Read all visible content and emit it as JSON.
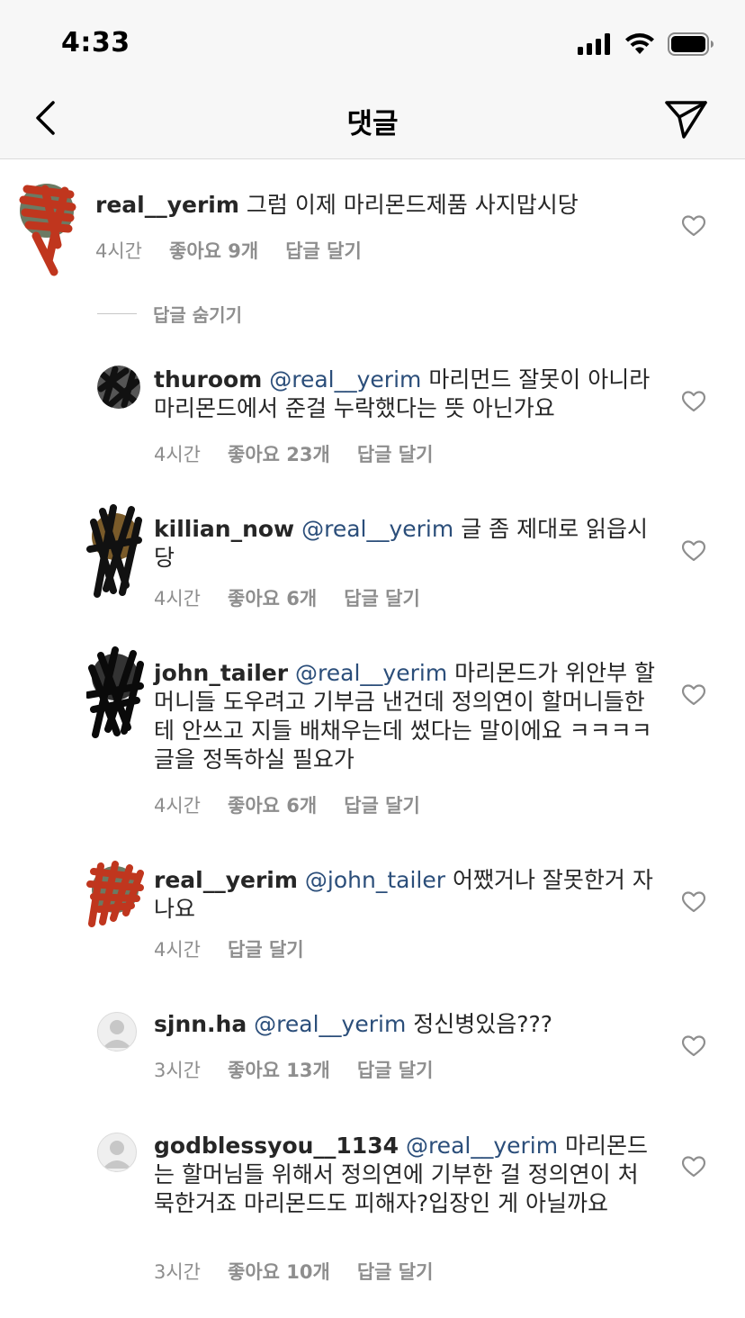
{
  "status_bar": {
    "time": "4:33"
  },
  "header": {
    "title": "댓글"
  },
  "hide_replies_label": "답글 숨기기",
  "comments": [
    {
      "username": "real__yerim",
      "mention": "",
      "text": "그럼 이제 마리몬드제품 사지맙시당",
      "time": "4시간",
      "likes": "좋아요 9개",
      "reply": "답글 달기"
    },
    {
      "username": "thuroom",
      "mention": "@real__yerim",
      "text": "마리먼드 잘못이 아니라 마리몬드에서 준걸 누락했다는 뜻 아닌가요",
      "time": "4시간",
      "likes": "좋아요 23개",
      "reply": "답글 달기"
    },
    {
      "username": "killian_now",
      "mention": "@real__yerim",
      "text": "글 좀 제대로 읽읍시당",
      "time": "4시간",
      "likes": "좋아요 6개",
      "reply": "답글 달기"
    },
    {
      "username": "john_tailer",
      "mention": "@real__yerim",
      "text": "마리몬드가 위안부 할머니들 도우려고 기부금 낸건데 정의연이 할머니들한테 안쓰고 지들 배채우는데 썼다는 말이에요 ㅋㅋㅋㅋ 글을 정독하실 필요가",
      "time": "4시간",
      "likes": "좋아요 6개",
      "reply": "답글 달기"
    },
    {
      "username": "real__yerim",
      "mention": "@john_tailer",
      "text": "어쨌거나 잘못한거 자나요",
      "time": "4시간",
      "likes": "",
      "reply": "답글 달기"
    },
    {
      "username": "sjnn.ha",
      "mention": "@real__yerim",
      "text": "정신병있음???",
      "time": "3시간",
      "likes": "좋아요 13개",
      "reply": "답글 달기"
    },
    {
      "username": "godblessyou__1134",
      "mention": "@real__yerim",
      "text": "마리몬드는 할머님들 위해서 정의연에 기부한 걸 정의연이 처묵한거죠 마리몬드도 피해자?입장인 게 아닐까요",
      "time": "3시간",
      "likes": "좋아요 10개",
      "reply": "답글 달기"
    }
  ]
}
